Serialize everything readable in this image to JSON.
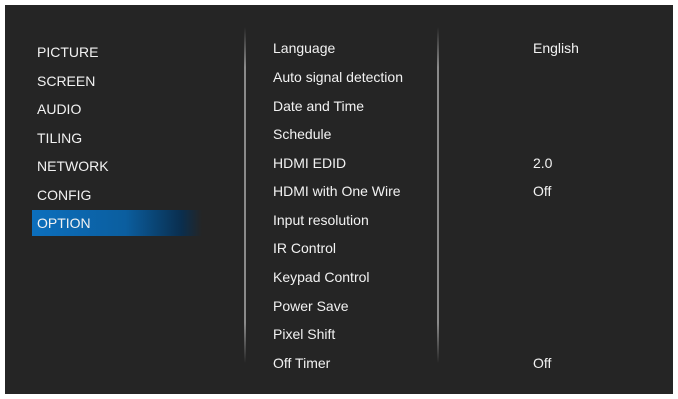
{
  "menu": {
    "main_items": [
      "PICTURE",
      "SCREEN",
      "AUDIO",
      "TILING",
      "NETWORK",
      "CONFIG",
      "OPTION"
    ],
    "selected_main": "OPTION",
    "option_items": [
      "Language",
      "Auto signal detection",
      "Date and Time",
      "Schedule",
      "HDMI EDID",
      "HDMI with One Wire",
      "Input resolution",
      "IR Control",
      "Keypad Control",
      "Power Save",
      "Pixel Shift",
      "Off Timer"
    ],
    "values": {
      "language": "English",
      "hdmi_edid": "2.0",
      "hdmi_with_one_wire": "Off",
      "off_timer": "Off"
    }
  },
  "colors": {
    "background": "#252525",
    "highlight": "#0c6fbd",
    "text": "#f2f2f2"
  }
}
